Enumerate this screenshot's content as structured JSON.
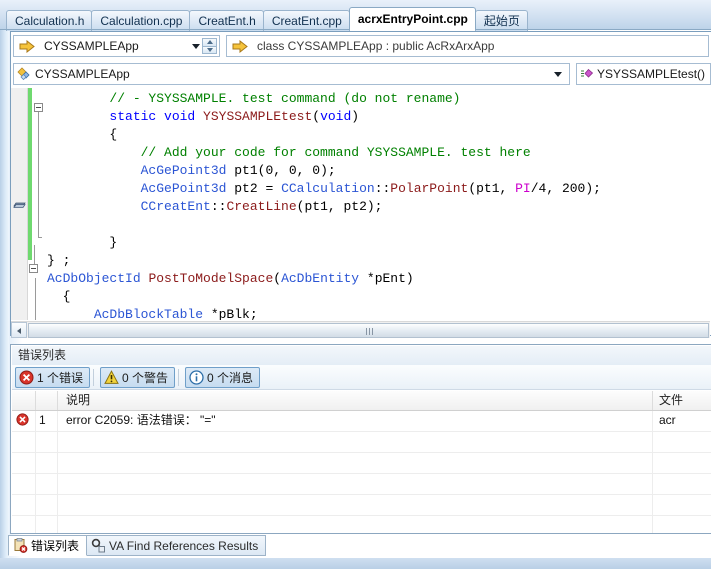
{
  "document_tabs": [
    {
      "label": "Calculation.h",
      "active": false
    },
    {
      "label": "Calculation.cpp",
      "active": false
    },
    {
      "label": "CreatEnt.h",
      "active": false
    },
    {
      "label": "CreatEnt.cpp",
      "active": false
    },
    {
      "label": "acrxEntryPoint.cpp",
      "active": true
    },
    {
      "label": "起始页",
      "active": false
    }
  ],
  "navbar": {
    "class_combo": "CYSSAMPLEApp",
    "signature_combo": "class CYSSAMPLEApp : public AcRxArxApp",
    "scope_combo": "CYSSAMPLEApp",
    "member_combo": "YSYSSAMPLEtest()",
    "class_icon": "arrow-right-icon",
    "signature_icon": "arrow-right-icon",
    "scope_icon": "class-icon",
    "member_icon": "method-icon",
    "dropdown_icon": "chevron-down-icon",
    "spinner_icon": "up-down-spinner-icon"
  },
  "code": {
    "lines": [
      [
        {
          "t": "        ",
          "c": "txt"
        },
        {
          "t": "// - YSYSSAMPLE. test command (do not rename)",
          "c": "cmt"
        }
      ],
      [
        {
          "t": "        ",
          "c": "txt"
        },
        {
          "t": "static void ",
          "c": "kw"
        },
        {
          "t": "YSYSSAMPLEtest",
          "c": "fn"
        },
        {
          "t": "(",
          "c": "txt"
        },
        {
          "t": "void",
          "c": "kw"
        },
        {
          "t": ")",
          "c": "txt"
        }
      ],
      [
        {
          "t": "        {",
          "c": "txt"
        }
      ],
      [
        {
          "t": "            ",
          "c": "txt"
        },
        {
          "t": "// Add your code for command YSYSSAMPLE. test here",
          "c": "cmt"
        }
      ],
      [
        {
          "t": "            ",
          "c": "txt"
        },
        {
          "t": "AcGePoint3d",
          "c": "type"
        },
        {
          "t": " pt1(0, 0, 0);",
          "c": "txt"
        }
      ],
      [
        {
          "t": "            ",
          "c": "txt"
        },
        {
          "t": "AcGePoint3d",
          "c": "type"
        },
        {
          "t": " pt2 = ",
          "c": "txt"
        },
        {
          "t": "CCalculation",
          "c": "type"
        },
        {
          "t": "::",
          "c": "txt"
        },
        {
          "t": "PolarPoint",
          "c": "fn"
        },
        {
          "t": "(pt1, ",
          "c": "txt"
        },
        {
          "t": "PI",
          "c": "mac"
        },
        {
          "t": "/4, 200);",
          "c": "txt"
        }
      ],
      [
        {
          "t": "            ",
          "c": "txt"
        },
        {
          "t": "CCreatEnt",
          "c": "type"
        },
        {
          "t": "::",
          "c": "txt"
        },
        {
          "t": "CreatLine",
          "c": "fn"
        },
        {
          "t": "(pt1, pt2);",
          "c": "txt"
        }
      ],
      [
        {
          "t": "",
          "c": "txt"
        }
      ],
      [
        {
          "t": "        }",
          "c": "txt"
        }
      ],
      [
        {
          "t": "} ;",
          "c": "txt"
        }
      ],
      [
        {
          "t": "AcDbObjectId",
          "c": "type"
        },
        {
          "t": " ",
          "c": "txt"
        },
        {
          "t": "PostToModelSpace",
          "c": "fn"
        },
        {
          "t": "(",
          "c": "txt"
        },
        {
          "t": "AcDbEntity",
          "c": "type"
        },
        {
          "t": " *pEnt)",
          "c": "txt"
        }
      ],
      [
        {
          "t": "  {",
          "c": "txt"
        }
      ],
      [
        {
          "t": "      ",
          "c": "txt"
        },
        {
          "t": "AcDbBlockTable",
          "c": "type"
        },
        {
          "t": " *pBlk;",
          "c": "txt"
        }
      ]
    ],
    "colors": {
      "comment": "#008000",
      "keyword": "#0000ff",
      "type": "#2b55d4",
      "function": "#8b1a1a",
      "macro": "#cc00cc",
      "plain": "#000000",
      "change_bar": "#6fd96f"
    },
    "bookmark_icon": "bookmark-icon",
    "fold_icon": "fold-collapse-icon",
    "hscroll": {
      "left_arrow_icon": "scroll-left-arrow-icon",
      "grip_icon": "scroll-grip-icon"
    }
  },
  "error_panel": {
    "title": "错误列表",
    "buttons": [
      {
        "label": "1 个错误",
        "icon": "error-icon",
        "active": true
      },
      {
        "label": "0 个警告",
        "icon": "warning-icon",
        "active": true
      },
      {
        "label": "0 个消息",
        "icon": "info-icon",
        "active": true
      }
    ],
    "columns": {
      "icon": "",
      "number": "",
      "description": "说明",
      "file": "文件"
    },
    "rows": [
      {
        "icon": "error-icon",
        "number": "1",
        "description": "error C2059: 语法错误：  \"=\"",
        "file": "acr"
      }
    ],
    "empty_rows": 5
  },
  "bottom_tabs": [
    {
      "label": "错误列表",
      "icon": "error-list-icon",
      "active": true
    },
    {
      "label": "VA Find References Results",
      "icon": "find-references-icon",
      "active": false
    }
  ]
}
